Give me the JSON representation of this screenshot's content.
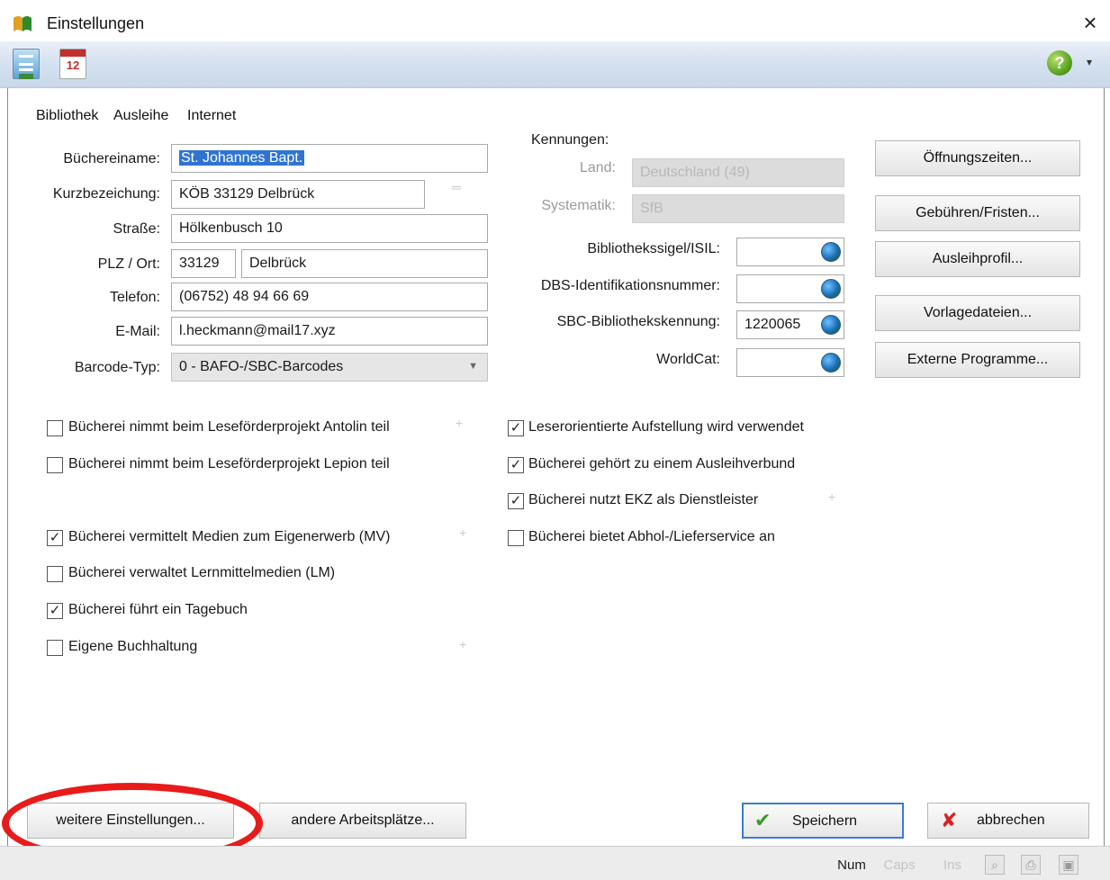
{
  "window": {
    "title": "Einstellungen",
    "close_symbol": "×"
  },
  "toolbar": {
    "help_label": "?",
    "dropdown_symbol": "▾",
    "calendar_label": "12"
  },
  "tabs": [
    "Bibliothek",
    "Ausleihe",
    "Internet"
  ],
  "form": {
    "name_label": "Büchereiname:",
    "name_value": "St. Johannes Bapt.",
    "short_label": "Kurzbezeichung:",
    "short_value": "KÖB 33129 Delbrück",
    "street_label": "Straße:",
    "street_value": "Hölkenbusch 10",
    "city_label": "PLZ / Ort:",
    "zip_value": "33129",
    "city_value": "Delbrück",
    "phone_label": "Telefon:",
    "phone_value": "(06752) 48 94 66 69",
    "email_label": "E-Mail:",
    "email_value": "l.heckmann@mail17.xyz",
    "barcode_label": "Barcode-Typ:",
    "barcode_value": "0 - BAFO-/SBC-Barcodes"
  },
  "ids": {
    "header": "Kennungen:",
    "country_label": "Land:",
    "country_value": "Deutschland (49)",
    "system_label": "Systematik:",
    "system_value": "SfB",
    "isil_label": "Bibliothekssigel/ISIL:",
    "isil_value": "",
    "dbs_label": "DBS-Identifikationsnummer:",
    "dbs_value": "",
    "sbc_label": "SBC-Bibliothekskennung:",
    "sbc_value": "1220065",
    "worldcat_label": "WorldCat:",
    "worldcat_value": ""
  },
  "side_buttons": [
    "Öffnungszeiten...",
    "Gebühren/Fristen...",
    "Ausleihprofil...",
    "Vorlagedateien...",
    "Externe Programme..."
  ],
  "checkboxes_left": [
    {
      "label": "Bücherei nimmt beim Leseförderprojekt Antolin teil",
      "checked": false
    },
    {
      "label": "Bücherei nimmt beim Leseförderprojekt Lepion teil",
      "checked": false
    },
    {
      "label": "Bücherei vermittelt Medien zum Eigenerwerb (MV)",
      "checked": true
    },
    {
      "label": "Bücherei verwaltet Lernmittelmedien (LM)",
      "checked": false
    },
    {
      "label": "Bücherei führt ein Tagebuch",
      "checked": true
    },
    {
      "label": "Eigene Buchhaltung",
      "checked": false
    }
  ],
  "checkboxes_right": [
    {
      "label": "Leserorientierte Aufstellung wird verwendet",
      "checked": true
    },
    {
      "label": "Bücherei gehört zu einem Ausleihverbund",
      "checked": true
    },
    {
      "label": "Bücherei nutzt EKZ als Dienstleister",
      "checked": true
    },
    {
      "label": "Bücherei bietet Abhol-/Lieferservice an",
      "checked": false
    }
  ],
  "bottom": {
    "more_settings": "weitere Einstellungen...",
    "other_workstations": "andere Arbeitsplätze...",
    "save": "Speichern",
    "cancel": "abbrechen"
  },
  "statusbar": [
    "Num",
    "Caps",
    "Ins"
  ],
  "colors": {
    "toolbar": "#d6e2f0",
    "selection": "#2f74d0",
    "annotation_ellipse": "#e81a1a"
  }
}
